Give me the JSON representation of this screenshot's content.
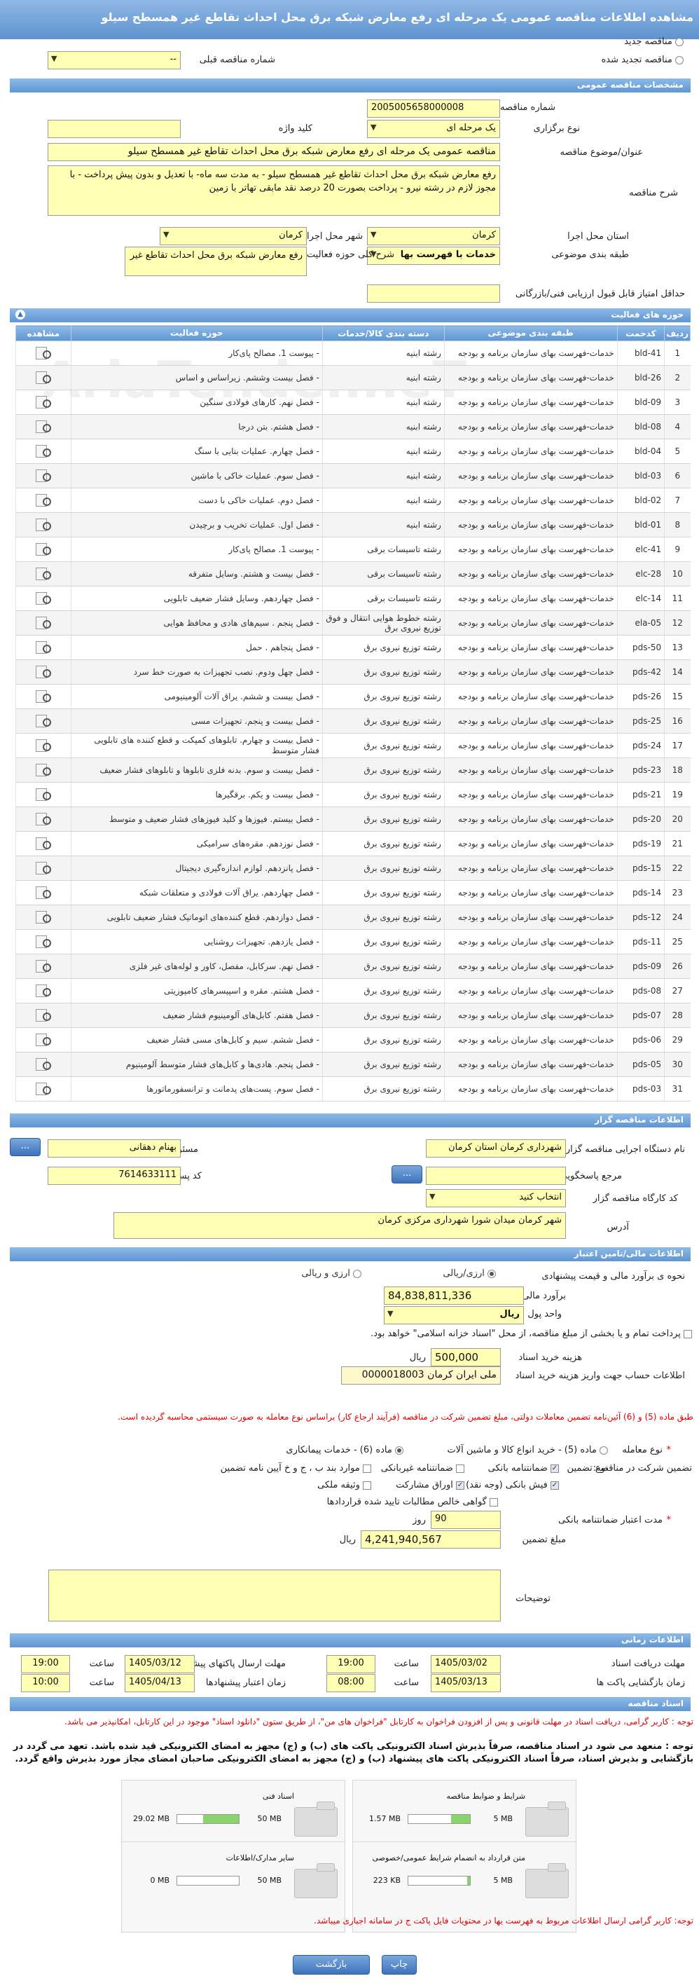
{
  "title": "مشاهده اطلاعات مناقصه عمومی یک مرحله ای رفع معارض شبکه برق محل احداث تقاطع غیر همسطح سیلو",
  "top": {
    "new_label": "مناقصه جدید",
    "renew_label": "مناقصه تجدید شده",
    "prev_label": "شماره مناقصه قبلی",
    "prev_value": "--"
  },
  "sections": {
    "general": "مشخصات مناقصه عمومی",
    "activity": "حوزه های فعالیت",
    "org": "اطلاعات مناقصه گزار",
    "finance": "اطلاعات مالی/تامین اعتبار",
    "time": "اطلاعات زمانی",
    "docs": "اسناد مناقصه"
  },
  "general": {
    "number_label": "شماره مناقصه",
    "number": "2005005658000008",
    "type_label": "نوع برگزاری",
    "type": "یک مرحله ای",
    "keyword_label": "کلید واژه",
    "keyword": "",
    "subject_label": "عنوان/موضوع مناقصه",
    "subject": "مناقصه عمومی یک مرحله ای رفع معارض شبکه برق محل احداث تقاطع غیر همسطح سیلو",
    "desc_label": "شرح مناقصه",
    "desc": "رفع معارض شبکه برق محل احداث تقاطع غیر همسطح سیلو - به مدت سه ماه- با تعدیل و بدون پیش پرداخت - با مجوز لازم در رشته نیرو - پرداخت بصورت 20 درصد نقد مابقی تهاتر با زمین",
    "province_label": "استان محل اجرا",
    "province": "کرمان",
    "city_label": "شهر محل اجرا",
    "city": "کرمان",
    "class_label": "طبقه بندی موضوعی",
    "class": "خدمات با فهرست بها",
    "scope_label": "شرح کلی حوزه فعالیت",
    "scope": "رفع معارض شبکه برق محل احداث تقاطع غیر",
    "minscore_label": "حداقل امتیاز قابل قبول ارزیابی فنی/بازرگانی",
    "minscore": ""
  },
  "table": {
    "headers": {
      "no": "ردیف",
      "code": "کدحمت",
      "class": "طبقه بندی موضوعی",
      "group": "دسته بندی کالا/خدمات",
      "field": "حوزه فعالیت",
      "view": "مشاهده"
    },
    "rows": [
      {
        "no": "1",
        "code": "bld-41",
        "cls": "خدمات-فهرست بهای سازمان برنامه و بودجه",
        "grp": "رشته ابنیه",
        "fld": "- پیوست 1. مصالح پای‌کار"
      },
      {
        "no": "2",
        "code": "bld-26",
        "cls": "خدمات-فهرست بهای سازمان برنامه و بودجه",
        "grp": "رشته ابنیه",
        "fld": "- فصل بیست وششم. زیراساس و اساس"
      },
      {
        "no": "3",
        "code": "bld-09",
        "cls": "خدمات-فهرست بهای سازمان برنامه و بودجه",
        "grp": "رشته ابنیه",
        "fld": "- فصل نهم. کارهای فولادی سنگین"
      },
      {
        "no": "4",
        "code": "bld-08",
        "cls": "خدمات-فهرست بهای سازمان برنامه و بودجه",
        "grp": "رشته ابنیه",
        "fld": "- فصل هشتم. بتن درجا"
      },
      {
        "no": "5",
        "code": "bld-04",
        "cls": "خدمات-فهرست بهای سازمان برنامه و بودجه",
        "grp": "رشته ابنیه",
        "fld": "- فصل چهارم. عملیات بنایی با سنگ"
      },
      {
        "no": "6",
        "code": "bld-03",
        "cls": "خدمات-فهرست بهای سازمان برنامه و بودجه",
        "grp": "رشته ابنیه",
        "fld": "- فصل سوم. عملیات خاکی با ماشین"
      },
      {
        "no": "7",
        "code": "bld-02",
        "cls": "خدمات-فهرست بهای سازمان برنامه و بودجه",
        "grp": "رشته ابنیه",
        "fld": "- فصل دوم. عملیات خاکی با دست"
      },
      {
        "no": "8",
        "code": "bld-01",
        "cls": "خدمات-فهرست بهای سازمان برنامه و بودجه",
        "grp": "رشته ابنیه",
        "fld": "- فصل اول. عملیات تخریب و برچیدن"
      },
      {
        "no": "9",
        "code": "elc-41",
        "cls": "خدمات-فهرست بهای سازمان برنامه و بودجه",
        "grp": "رشته تاسیسات برقی",
        "fld": "- پیوست 1. مصالح پای‌کار"
      },
      {
        "no": "10",
        "code": "elc-28",
        "cls": "خدمات-فهرست بهای سازمان برنامه و بودجه",
        "grp": "رشته تاسیسات برقی",
        "fld": "- فصل بیست و هشتم. وسایل متفرقه"
      },
      {
        "no": "11",
        "code": "elc-14",
        "cls": "خدمات-فهرست بهای سازمان برنامه و بودجه",
        "grp": "رشته تاسیسات برقی",
        "fld": "- فصل چهاردهم. وسایل فشار ضعیف تابلویی"
      },
      {
        "no": "12",
        "code": "ela-05",
        "cls": "خدمات-فهرست بهای سازمان برنامه و بودجه",
        "grp": "رشته خطوط هوایی انتقال و فوق توزیع نیروی برق",
        "fld": "- فصل پنجم . سیم‌های هادی و محافظ هوایی"
      },
      {
        "no": "13",
        "code": "pds-50",
        "cls": "خدمات-فهرست بهای سازمان برنامه و بودجه",
        "grp": "رشته توزیع نیروی برق",
        "fld": "- فصل پنجاهم . حمل"
      },
      {
        "no": "14",
        "code": "pds-42",
        "cls": "خدمات-فهرست بهای سازمان برنامه و بودجه",
        "grp": "رشته توزیع نیروی برق",
        "fld": "- فصل چهل ودوم. نصب تجهیزات به صورت خط سرد"
      },
      {
        "no": "15",
        "code": "pds-26",
        "cls": "خدمات-فهرست بهای سازمان برنامه و بودجه",
        "grp": "رشته توزیع نیروی برق",
        "fld": "- فصل بیست و ششم. یراق آلات آلومینیومی"
      },
      {
        "no": "16",
        "code": "pds-25",
        "cls": "خدمات-فهرست بهای سازمان برنامه و بودجه",
        "grp": "رشته توزیع نیروی برق",
        "fld": "- فصل بیست و پنجم. تجهیزات مسی"
      },
      {
        "no": "17",
        "code": "pds-24",
        "cls": "خدمات-فهرست بهای سازمان برنامه و بودجه",
        "grp": "رشته توزیع نیروی برق",
        "fld": "- فصل بیست و چهارم. تابلوهای کمپکت و قطع کننده های تابلویی فشار متوسط"
      },
      {
        "no": "18",
        "code": "pds-23",
        "cls": "خدمات-فهرست بهای سازمان برنامه و بودجه",
        "grp": "رشته توزیع نیروی برق",
        "fld": "- فصل بیست و سوم. بدنه فلزی تابلوها و تابلوهای فشار ضعیف"
      },
      {
        "no": "19",
        "code": "pds-21",
        "cls": "خدمات-فهرست بهای سازمان برنامه و بودجه",
        "grp": "رشته توزیع نیروی برق",
        "fld": "- فصل بیست و یکم. برقگیرها"
      },
      {
        "no": "20",
        "code": "pds-20",
        "cls": "خدمات-فهرست بهای سازمان برنامه و بودجه",
        "grp": "رشته توزیع نیروی برق",
        "fld": "- فصل بیستم. فیوزها و کلید فیوزهای فشار ضعیف و متوسط"
      },
      {
        "no": "21",
        "code": "pds-19",
        "cls": "خدمات-فهرست بهای سازمان برنامه و بودجه",
        "grp": "رشته توزیع نیروی برق",
        "fld": "- فصل نوزدهم. مقره‌های سرامیکی"
      },
      {
        "no": "22",
        "code": "pds-15",
        "cls": "خدمات-فهرست بهای سازمان برنامه و بودجه",
        "grp": "رشته توزیع نیروی برق",
        "fld": "- فصل پانزدهم. لوازم اندازه‌گیری دیجیتال"
      },
      {
        "no": "23",
        "code": "pds-14",
        "cls": "خدمات-فهرست بهای سازمان برنامه و بودجه",
        "grp": "رشته توزیع نیروی برق",
        "fld": "- فصل چهاردهم. یراق آلات فولادی و متعلقات شبکه"
      },
      {
        "no": "24",
        "code": "pds-12",
        "cls": "خدمات-فهرست بهای سازمان برنامه و بودجه",
        "grp": "رشته توزیع نیروی برق",
        "fld": "- فصل دوازدهم. قطع کننده‌های اتوماتیک فشار ضعیف تابلویی"
      },
      {
        "no": "25",
        "code": "pds-11",
        "cls": "خدمات-فهرست بهای سازمان برنامه و بودجه",
        "grp": "رشته توزیع نیروی برق",
        "fld": "- فصل یازدهم. تجهیزات روشنایی"
      },
      {
        "no": "26",
        "code": "pds-09",
        "cls": "خدمات-فهرست بهای سازمان برنامه و بودجه",
        "grp": "رشته توزیع نیروی برق",
        "fld": "- فصل نهم. سرکابل، مفصل، کاور و لوله‌های غیر فلزی"
      },
      {
        "no": "27",
        "code": "pds-08",
        "cls": "خدمات-فهرست بهای سازمان برنامه و بودجه",
        "grp": "رشته توزیع نیروی برق",
        "fld": "- فصل هشتم. مقره و اسپیسرهای کامپوزیتی"
      },
      {
        "no": "28",
        "code": "pds-07",
        "cls": "خدمات-فهرست بهای سازمان برنامه و بودجه",
        "grp": "رشته توزیع نیروی برق",
        "fld": "- فصل هفتم. کابل‌های آلومینیوم فشار ضعیف"
      },
      {
        "no": "29",
        "code": "pds-06",
        "cls": "خدمات-فهرست بهای سازمان برنامه و بودجه",
        "grp": "رشته توزیع نیروی برق",
        "fld": "- فصل ششم. سیم و کابل‌های مسی فشار ضعیف"
      },
      {
        "no": "30",
        "code": "pds-05",
        "cls": "خدمات-فهرست بهای سازمان برنامه و بودجه",
        "grp": "رشته توزیع نیروی برق",
        "fld": "- فصل پنجم. هادی‌ها و کابل‌های فشار متوسط آلومینیوم"
      },
      {
        "no": "31",
        "code": "pds-03",
        "cls": "خدمات-فهرست بهای سازمان برنامه و بودجه",
        "grp": "رشته توزیع نیروی برق",
        "fld": "- فصل سوم. پست‌های پدمانت و ترانسفورماتورها"
      }
    ]
  },
  "org": {
    "exec_label": "نام دستگاه اجرایی مناقصه گزار",
    "exec": "شهرداری کرمان استان کرمان",
    "resp_label": "مسئول ثبت مناقصه",
    "resp": "بهنام دهقانی",
    "ref_label": "مرجع پاسخگویی",
    "ref": "",
    "postal_label": "کد پستی",
    "postal": "7614633111",
    "work_label": "کد کارگاه مناقصه گزار",
    "work": "انتخاب کنید",
    "addr_label": "آدرس",
    "addr": "شهر کرمان میدان شورا شهرداری مرکزی کرمان",
    "btn_dots": "..."
  },
  "finance": {
    "est_label": "نحوه ی برآورد مالی و قیمت پیشنهادی",
    "rial": "ارزی/ریالی",
    "fx_rial": "ارزی و ریالی",
    "est_amount_label": "برآورد مالی",
    "est_amount": "84,838,811,336",
    "unit_label": "واحد پول",
    "unit": "ریال",
    "note": "پرداخت تمام و یا بخشی از مبلغ مناقصه، از محل \"اسناد خزانه اسلامی\" خواهد بود.",
    "fee_label": "هزینه خرید اسناد",
    "fee": "500,000",
    "fee_unit": "ریال",
    "acct_label": "اطلاعات حساب جهت واریز هزینه خرید اسناد",
    "acct": "ملی ایران کرمان 0000018003",
    "red_note": "طبق ماده (5) و (6) آئین‌نامه تضمین معاملات دولتی، مبلغ تضمین شرکت در مناقصه (فرآیند ارجاع کار) براساس نوع معامله به صورت سیستمی محاسبه گردیده است.",
    "deal_label": "نوع معامله",
    "deal5": "ماده (5) - خرید انواع کالا و ماشین آلات",
    "deal6": "ماده (6) - خدمات پیمانکاری",
    "guar_label": "تضمین شرکت در مناقصه:",
    "guar_type": "نوع تضمین",
    "g1": "ضمانتنامه بانکی",
    "g2": "ضمانتنامه غیربانکی",
    "g3": "موارد بند ب ، ج و خ آیین نامه تضمین",
    "g4": "فیش بانکی (وجه نقد)",
    "g5": "اوراق مشارکت",
    "g6": "وثیقه ملکی",
    "g7": "گواهی خالص مطالبات تایید شده قراردادها",
    "valid_label": "مدت اعتبار ضمانتنامه بانکی",
    "valid": "90",
    "valid_unit": "روز",
    "gamount_label": "مبلغ تضمین",
    "gamount": "4,241,940,567",
    "gamount_unit": "ریال",
    "notes_label": "توضیحات"
  },
  "time": {
    "get_label": "مهلت دریافت اسناد",
    "get_date": "1405/03/02",
    "get_time": "19:00",
    "send_label": "مهلت ارسال پاکتهای پیشنهادی",
    "send_date": "1405/03/12",
    "send_time": "19:00",
    "open_label": "زمان بازگشایی پاکت ها",
    "open_date": "1405/03/13",
    "open_time": "08:00",
    "valid_label": "زمان اعتبار پیشنهادها",
    "valid_date": "1405/04/13",
    "valid_time": "10:00",
    "time_label": "ساعت"
  },
  "docs": {
    "note1": "توجه : کاربر گرامی، دریافت اسناد در مهلت قانونی و پس از افزودن فراخوان به کارتابل \"فراخوان های من\"، از طریق ستون \"دانلود اسناد\" موجود در این کارتابل، امکانپذیر می باشد.",
    "note2": "توجه : منعهد می شود در اسناد مناقصه، صرفاً بذیرش اسناد الکترونیکی پاکت های (ب) و (ج) مجهز به امضای الکترونیکی قید شده باشد. تعهد می گردد در بازگشایی و بذیرش اسناد، صرفاً اسناد الکترونیکی پاکت های پیشنهاد (ب) و (ج) مجهز به امضای الکترونیکی صاحبان امضای مجاز مورد بذیرش واقع گردد.",
    "boxes": [
      {
        "title": "شرایط و ضوابط مناقصه",
        "used": "1.57 MB",
        "total": "5 MB",
        "frac": 0.31
      },
      {
        "title": "اسناد فنی",
        "used": "29.02 MB",
        "total": "50 MB",
        "frac": 0.58
      },
      {
        "title": "متن قرارداد به انضمام شرایط عمومی/خصوصی",
        "used": "223 KB",
        "total": "5 MB",
        "frac": 0.05
      },
      {
        "title": "سایر مدارک/اطلاعات",
        "used": "0 MB",
        "total": "50 MB",
        "frac": 0
      }
    ],
    "note3": "توجه: کاربر گرامی ارسال اطلاعات مربوط به فهرست بها در محتویات فایل پاکت ج در سامانه اجباری میباشد."
  },
  "buttons": {
    "print": "چاپ",
    "back": "بازگشت"
  },
  "watermark": "AriaTender.neT"
}
